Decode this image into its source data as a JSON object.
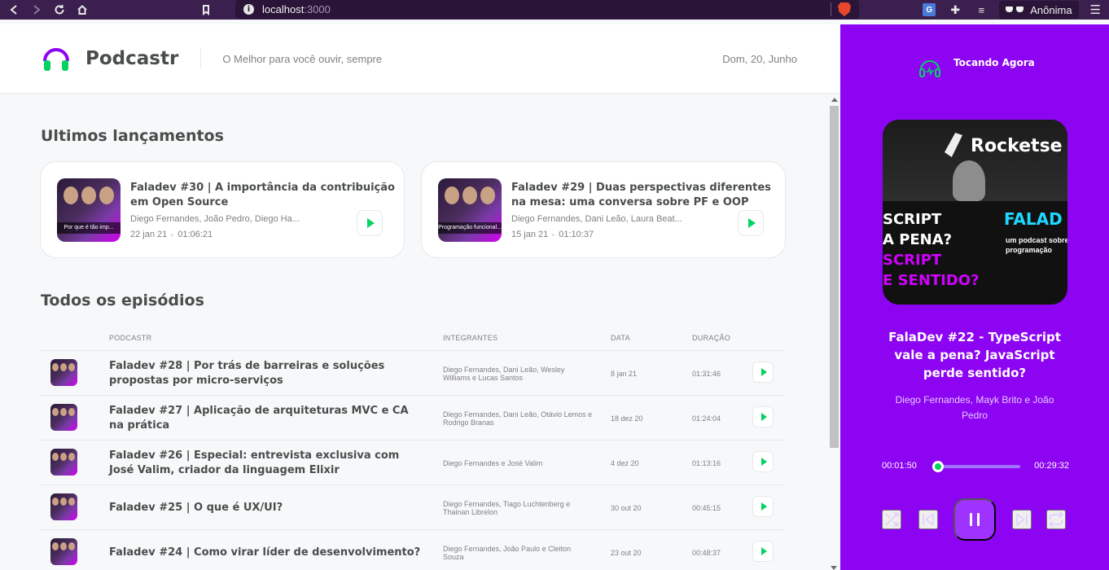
{
  "browser": {
    "url_host": "localhost",
    "url_port": ":3000",
    "profile_label": "Anônima"
  },
  "header": {
    "brand": "Podcastr",
    "tagline": "O Melhor para você ouvir, sempre",
    "date": "Dom, 20, Junho"
  },
  "latest": {
    "title": "Ultimos lançamentos",
    "episodes": [
      {
        "title": "Faladev #30 | A importância da contribuição em Open Source",
        "members": "Diego Fernandes, João Pedro, Diego Ha...",
        "date": "22 jan 21",
        "duration": "01:06:21",
        "thumb_caption": "Por que é tão imp..."
      },
      {
        "title": "Faladev #29 | Duas perspectivas diferentes na mesa: uma conversa sobre PF e OOP",
        "members": "Diego Fernandes, Dani Leão, Laura Beat...",
        "date": "15 jan 21",
        "duration": "01:10:37",
        "thumb_caption": "Programação funcional..."
      }
    ]
  },
  "all": {
    "title": "Todos os episódios",
    "columns": [
      "Podcastr",
      "Integrantes",
      "Data",
      "Duração"
    ],
    "episodes": [
      {
        "title": "Faladev #28 | Por trás de barreiras e soluções propostas por micro-serviços",
        "members": "Diego Fernandes, Dani Leão, Wesley Williams e Lucas Santos",
        "date": "8 jan 21",
        "duration": "01:31:46"
      },
      {
        "title": "Faladev #27 | Aplicação de arquiteturas MVC e CA na prática",
        "members": "Diego Fernandes, Dani Leão, Otávio Lemos e Rodrigo Branas",
        "date": "18 dez 20",
        "duration": "01:24:04"
      },
      {
        "title": "Faladev #26 | Especial: entrevista exclusiva com José Valim, criador da linguagem Elixir",
        "members": "Diego Fernandes e José Valim",
        "date": "4 dez 20",
        "duration": "01:13:16"
      },
      {
        "title": "Faladev #25 | O que é UX/UI?",
        "members": "Diego Fernandes, Tiago Luchtenberg e Thainan Librelon",
        "date": "30 out 20",
        "duration": "00:45:15"
      },
      {
        "title": "Faladev #24 | Como virar líder de desenvolvimento?",
        "members": "Diego Fernandes, João Paulo e Cleiton Souza",
        "date": "23 out 20",
        "duration": "00:48:37"
      }
    ]
  },
  "player": {
    "heading": "Tocando Agora",
    "title": "FalaDev #22 - TypeScript vale a pena? JavaScript perde sentido?",
    "members": "Diego Fernandes, Mayk Brito e João Pedro",
    "current_time": "00:01:50",
    "total_time": "00:29:32",
    "progress_fraction": 0.062,
    "cover": {
      "brand": "Rocketse",
      "line1": "SCRIPT",
      "line2": "A PENA?",
      "line3": "SCRIPT",
      "line4": "E SENTIDO?",
      "side_title": "FALAD",
      "side_sub": "um podcast sobre programação"
    }
  },
  "colors": {
    "brand_purple": "#8c04f2",
    "accent_green": "#04d361",
    "text_dark": "#494d4b",
    "text_muted": "#808080"
  }
}
